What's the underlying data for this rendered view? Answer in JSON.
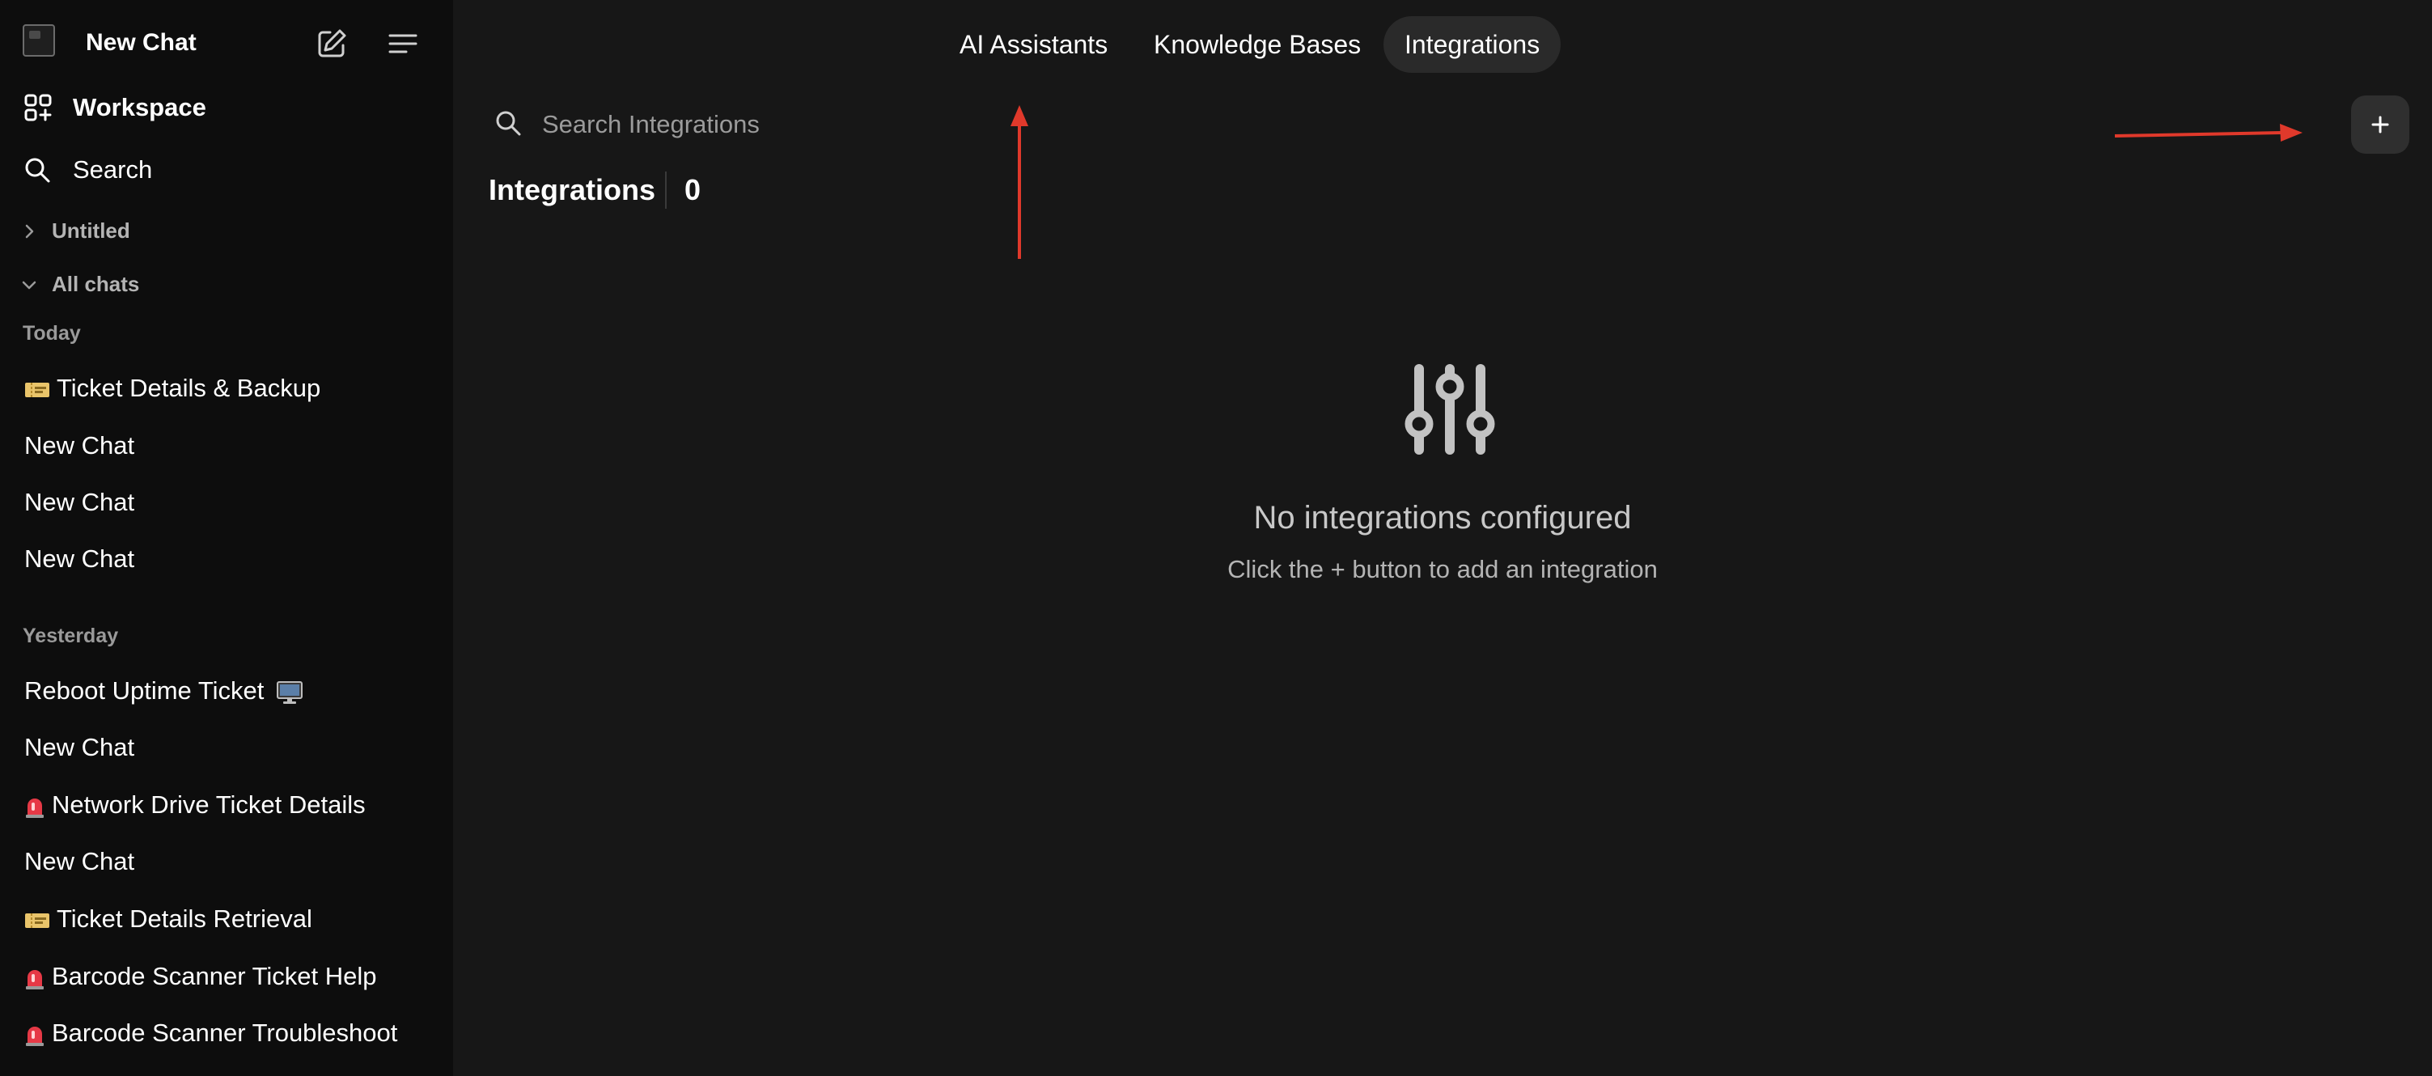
{
  "sidebar": {
    "app_title": "New Chat",
    "workspace_label": "Workspace",
    "search_label": "Search",
    "folders": [
      {
        "label": "Untitled",
        "expanded": false
      },
      {
        "label": "All chats",
        "expanded": true
      }
    ],
    "groups": [
      {
        "label": "Today",
        "chats": [
          {
            "emoji": "ticket",
            "title": "Ticket Details & Backup"
          },
          {
            "emoji": "",
            "title": "New Chat"
          },
          {
            "emoji": "",
            "title": "New Chat"
          },
          {
            "emoji": "",
            "title": "New Chat"
          }
        ]
      },
      {
        "label": "Yesterday",
        "chats": [
          {
            "emoji": "monitor",
            "title": "Reboot Uptime Ticket"
          },
          {
            "emoji": "",
            "title": "New Chat"
          },
          {
            "emoji": "siren",
            "title": "Network Drive Ticket Details"
          },
          {
            "emoji": "",
            "title": "New Chat"
          },
          {
            "emoji": "ticket",
            "title": "Ticket Details Retrieval"
          },
          {
            "emoji": "siren",
            "title": "Barcode Scanner Ticket Help"
          },
          {
            "emoji": "siren",
            "title": "Barcode Scanner Troubleshoot"
          }
        ]
      }
    ]
  },
  "main": {
    "tabs": [
      {
        "label": "AI Assistants",
        "active": false
      },
      {
        "label": "Knowledge Bases",
        "active": false
      },
      {
        "label": "Integrations",
        "active": true
      }
    ],
    "search_placeholder": "Search Integrations",
    "section_title": "Integrations",
    "section_count": "0",
    "empty_title": "No integrations configured",
    "empty_subtitle": "Click the + button to add an integration"
  },
  "colors": {
    "sidebar_bg": "#0d0d0d",
    "main_bg": "#171717",
    "active_tab_bg": "#2a2a2a",
    "annotation_red": "#e0392b"
  }
}
